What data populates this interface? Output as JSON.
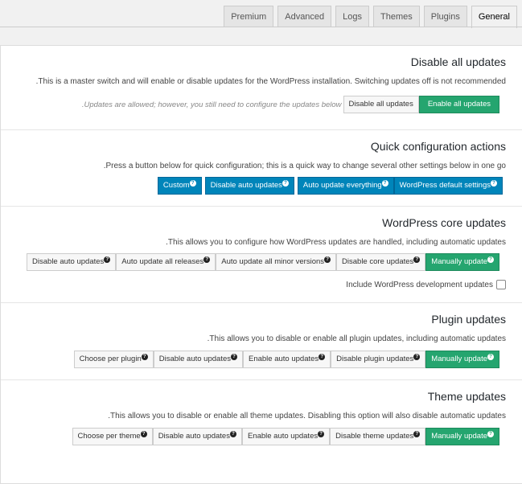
{
  "tabs": [
    "General",
    "Plugins",
    "Themes",
    "Logs",
    "Advanced",
    "Premium"
  ],
  "active_tab": "General",
  "colors": {
    "green": "#25a56f",
    "blue": "#0085ba"
  },
  "sections": {
    "all": {
      "title": "Disable all updates",
      "desc": ".This is a master switch and will enable or disable updates for the WordPress installation. Switching updates off is not recommended",
      "note": ".Updates are allowed; however, you still need to configure the updates below",
      "buttons": [
        "Disable all updates",
        "Enable all updates"
      ]
    },
    "quick": {
      "title": "Quick configuration actions",
      "desc": ".Press a button below for quick configuration; this is a quick way to change several other settings below in one go",
      "buttons": [
        "Custom",
        "Disable auto updates",
        "Auto update everything",
        "WordPress default settings"
      ]
    },
    "core": {
      "title": "WordPress core updates",
      "desc": ".This allows you to configure how WordPress updates are handled, including automatic updates",
      "buttons": [
        "Disable auto updates",
        "Auto update all releases",
        "Auto update all minor versions",
        "Disable core updates",
        "Manually update"
      ],
      "checkbox": "Include WordPress development updates"
    },
    "plugin": {
      "title": "Plugin updates",
      "desc": ".This allows you to disable or enable all plugin updates, including automatic updates",
      "buttons": [
        "Choose per plugin",
        "Disable auto updates",
        "Enable auto updates",
        "Disable plugin updates",
        "Manually update"
      ]
    },
    "theme": {
      "title": "Theme updates",
      "desc": ".This allows you to disable or enable all theme updates. Disabling this option will also disable automatic updates",
      "buttons": [
        "Choose per theme",
        "Disable auto updates",
        "Enable auto updates",
        "Disable theme updates",
        "Manually update"
      ]
    }
  }
}
